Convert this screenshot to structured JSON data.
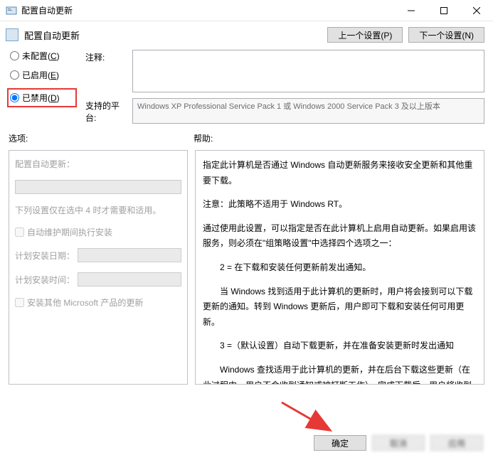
{
  "titlebar": {
    "title": "配置自动更新"
  },
  "header": {
    "title": "配置自动更新",
    "prev": "上一个设置(P)",
    "next": "下一个设置(N)"
  },
  "radios": {
    "not_configured": "未配置(",
    "not_configured_u": "C",
    "not_configured_end": ")",
    "enabled": "已启用(",
    "enabled_u": "E",
    "enabled_end": ")",
    "disabled": "已禁用(",
    "disabled_u": "D",
    "disabled_end": ")"
  },
  "fields": {
    "comment_label": "注释:",
    "platform_label": "支持的平台:",
    "platform_text": "Windows XP Professional Service Pack 1 或 Windows 2000 Service Pack 3 及以上版本"
  },
  "sections": {
    "options": "选项:",
    "help": "帮助:"
  },
  "options": {
    "heading": "配置自动更新：",
    "note": "下列设置仅在选中 4 时才需要和适用。",
    "auto_maint": "自动维护期间执行安装",
    "plan_date": "计划安装日期：",
    "plan_time": "计划安装时间：",
    "install_other": "安装其他 Microsoft 产品的更新"
  },
  "help": {
    "p1": "指定此计算机是否通过 Windows 自动更新服务来接收安全更新和其他重要下载。",
    "p2": "注意：此策略不适用于 Windows RT。",
    "p3": "通过使用此设置，可以指定是否在此计算机上启用自动更新。如果启用该服务，则必须在\"组策略设置\"中选择四个选项之一：",
    "p4": "2 = 在下载和安装任何更新前发出通知。",
    "p5": "当 Windows 找到适用于此计算机的更新时，用户将会接到可以下载更新的通知。转到 Windows 更新后，用户即可下载和安装任何可用更新。",
    "p6": "3 =（默认设置）自动下载更新，并在准备安装更新时发出通知",
    "p7": "Windows 查找适用于此计算机的更新，并在后台下载这些更新（在此过程中，用户不会收到通知或被打断工作）。完成下载后，用户将收到可以安装更新的通知。转到 Windows 更新后"
  },
  "footer": {
    "ok": "确定",
    "cancel": "取消",
    "apply": "应用"
  }
}
